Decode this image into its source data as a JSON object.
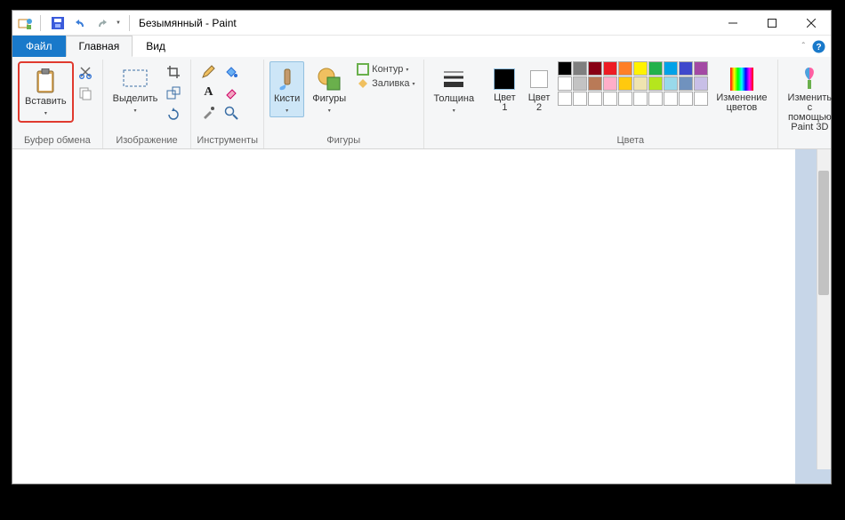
{
  "title": "Безымянный - Paint",
  "tabs": {
    "file": "Файл",
    "home": "Главная",
    "view": "Вид"
  },
  "groups": {
    "clipboard": {
      "paste": "Вставить",
      "label": "Буфер обмена"
    },
    "image": {
      "select": "Выделить",
      "label": "Изображение"
    },
    "tools": {
      "label": "Инструменты"
    },
    "brushes": {
      "brushes": "Кисти"
    },
    "shapes": {
      "shapes": "Фигуры",
      "outline": "Контур",
      "fill": "Заливка",
      "label": "Фигуры"
    },
    "size": {
      "size": "Толщина"
    },
    "colors": {
      "c1": "Цвет 1",
      "c2": "Цвет 2",
      "edit": "Изменение цветов",
      "label": "Цвета"
    },
    "p3d": {
      "label": "Изменить с помощью Paint 3D"
    }
  },
  "palette": {
    "row1": [
      "#000000",
      "#7f7f7f",
      "#880015",
      "#ed1c24",
      "#ff7f27",
      "#fff200",
      "#22b14c",
      "#00a2e8",
      "#3f48cc",
      "#a349a4"
    ],
    "row2": [
      "#ffffff",
      "#c3c3c3",
      "#b97a57",
      "#ffaec9",
      "#ffc90e",
      "#efe4b0",
      "#b5e61d",
      "#99d9ea",
      "#7092be",
      "#c8bfe7"
    ],
    "row3": [
      "#ffffff",
      "#ffffff",
      "#ffffff",
      "#ffffff",
      "#ffffff",
      "#ffffff",
      "#ffffff",
      "#ffffff",
      "#ffffff",
      "#ffffff"
    ]
  },
  "c1": "#000000",
  "c2": "#ffffff"
}
